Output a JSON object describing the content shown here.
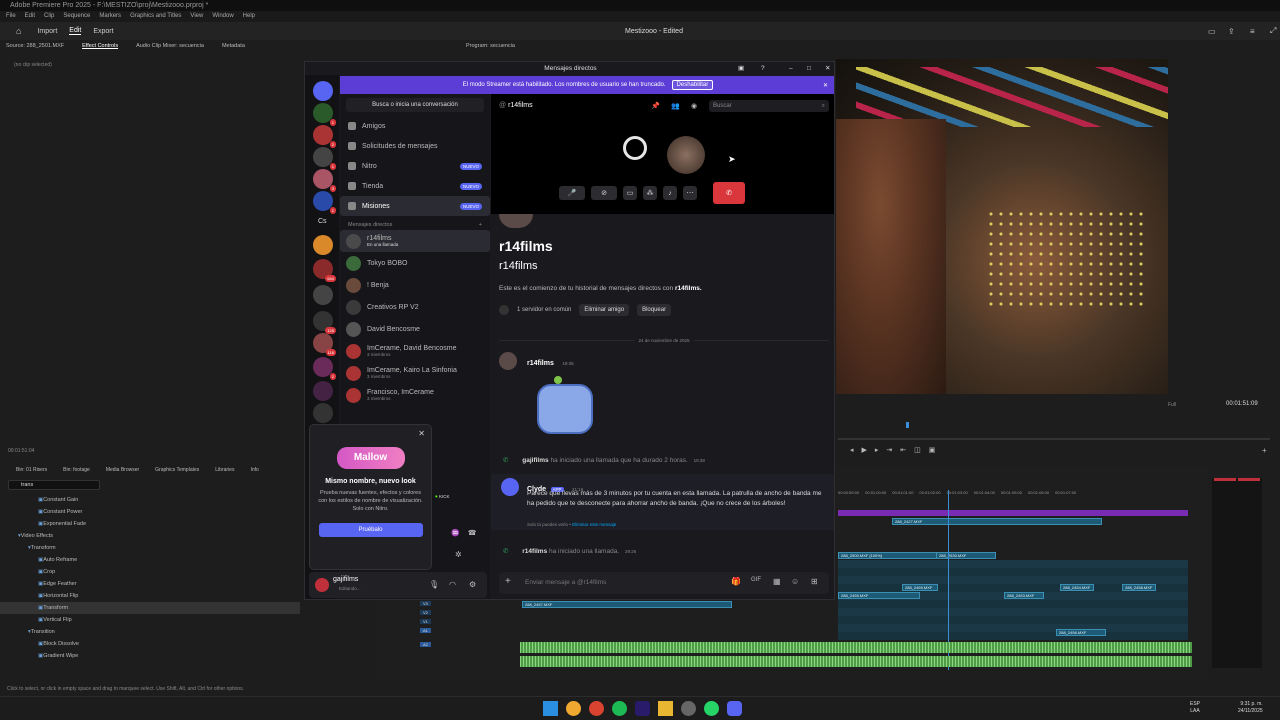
{
  "premiere": {
    "title": "Adobe Premiere Pro 2025 - F:\\MESTIZO\\proj\\Mestizooo.prproj *",
    "menu": [
      "File",
      "Edit",
      "Clip",
      "Sequence",
      "Markers",
      "Graphics and Titles",
      "View",
      "Window",
      "Help"
    ],
    "workspace_tabs": [
      "Import",
      "Edit",
      "Export"
    ],
    "project_name": "Mestizooo - Edited",
    "source_tabs": [
      "Source: 288_2501.MXF",
      "Effect Controls",
      "Audio Clip Mixer: secuencia",
      "Metadata"
    ],
    "no_clip": "(no clip selected)",
    "program_tab": "Program: secuencia",
    "source_timecode": "00:01:51:04",
    "program_zoom": "Full",
    "program_timecode": "00:01:51:09",
    "bin_tabs": [
      "Bin: 01 Risers",
      "Bin: footage",
      "Media Browser",
      "Graphics Templates",
      "Libraries",
      "Info"
    ],
    "effects_search": "trans",
    "effects_tree": [
      {
        "label": "Constant Gain",
        "indent": 2
      },
      {
        "label": "Constant Power",
        "indent": 2
      },
      {
        "label": "Exponential Fade",
        "indent": 2
      },
      {
        "label": "Video Effects",
        "indent": 0
      },
      {
        "label": "Transform",
        "indent": 1
      },
      {
        "label": "Auto Reframe",
        "indent": 2
      },
      {
        "label": "Crop",
        "indent": 2
      },
      {
        "label": "Edge Feather",
        "indent": 2
      },
      {
        "label": "Horizontal Flip",
        "indent": 2
      },
      {
        "label": "Transform",
        "indent": 2
      },
      {
        "label": "Vertical Flip",
        "indent": 2
      },
      {
        "label": "Transition",
        "indent": 1
      },
      {
        "label": "Block Dissolve",
        "indent": 2
      },
      {
        "label": "Gradient Wipe",
        "indent": 2
      }
    ],
    "ruler": [
      "00:01:00:00",
      "00:01:01:00",
      "00:01:02:00",
      "00:01:03:00",
      "00:01:04:00",
      "00:01:05:00",
      "00:01:06:00",
      "00:01:07:00"
    ],
    "ruler_first": "00:00:59:00",
    "track_labels": [
      "V3",
      "V2",
      "V1",
      "A1",
      "A2"
    ],
    "clips": [
      "288_2427.MXF",
      "288_2500.MXF [100%]",
      "288_2530.MXF",
      "288_2469.MXF",
      "288_2454.MXF",
      "288_2458.MXF",
      "288_2455.MXF",
      "288_2453.MXF",
      "288_2457.MXF",
      "288_2456.MXF"
    ],
    "status": "Click to select, or click in empty space and drag to marquee select. Use Shift, Alt, and Ctrl for other options."
  },
  "discord": {
    "window_title": "Mensajes directos",
    "streamer_banner": "El modo Streamer está habilitado. Los nombres de usuario se han truncado.",
    "banner_button": "Deshabilitar",
    "search_conversation": "Busca o inicia una conversación",
    "nav": [
      {
        "label": "Amigos",
        "badge": ""
      },
      {
        "label": "Solicitudes de mensajes",
        "badge": ""
      },
      {
        "label": "Nitro",
        "badge": "NUEVO"
      },
      {
        "label": "Tienda",
        "badge": "NUEVO"
      },
      {
        "label": "Misiones",
        "badge": "NUEVO"
      }
    ],
    "dm_header": "Mensajes directos",
    "dms": [
      {
        "name": "r14films",
        "sub": "En una llamada"
      },
      {
        "name": "Tokyo BOBO",
        "sub": ""
      },
      {
        "name": "! Benja",
        "sub": ""
      },
      {
        "name": "Creativos RP V2",
        "sub": ""
      },
      {
        "name": "David Bencosme",
        "sub": ""
      },
      {
        "name": "ImCerame, David Bencosme",
        "sub": "3 miembros"
      },
      {
        "name": "ImCerame, Kairo La Sinfonia",
        "sub": "3 miembros"
      },
      {
        "name": "Francisco, ImCerame",
        "sub": "3 miembros"
      }
    ],
    "guild_text": "Cs",
    "guild_badges": [
      "1",
      "2",
      "1",
      "3",
      "1",
      "644",
      "128",
      "116",
      "2"
    ],
    "channel_name": "r14films",
    "search_placeholder": "Buscar",
    "profile_name_big": "r14films",
    "profile_name": "r14films",
    "intro": "Este es el comienzo de tu historial de mensajes directos con ",
    "intro_bold": "r14films.",
    "mutual": "1 servidor en común",
    "remove_friend": "Eliminar amigo",
    "block": "Bloquear",
    "date_divider": "24 de noviembre de 2025",
    "messages": [
      {
        "author": "r14films",
        "time": "19:36"
      },
      {
        "system_user": "gajifilms",
        "text": "ha iniciado una llamada que ha durado 2 horas.",
        "time": "19:38"
      },
      {
        "author": "Clyde",
        "tag": "APP",
        "time": "21:16",
        "text": "Parece que llevas más de 3 minutos por tu cuenta en esta llamada. La patrulla de ancho de banda me ha pedido que te desconecte para ahorrar ancho de banda. ¡Que no crece de los árboles!",
        "footer": "Solo tú puedes verlo •",
        "footer_link": "Eliminar este mensaje"
      },
      {
        "system_user": "r14films",
        "text": "ha iniciado una llamada.",
        "time": "29:26"
      }
    ],
    "composer_placeholder": "Enviar mensaje a @r14films",
    "promo": {
      "logo_text": "Mallow",
      "title": "Mismo nombre, nuevo look",
      "body": "Prueba nuevas fuentes, efectos y colores con los estilos de nombre de visualización.",
      "body2": "Solo con Nitro.",
      "button": "Pruébalo"
    },
    "kick": "KICK",
    "user_name": "gajifilms",
    "user_status": "Editando..."
  },
  "taskbar": {
    "lang_top": "ESP",
    "lang_bottom": "LAA",
    "time": "9:31 p. m.",
    "date": "24/11/2025"
  },
  "colors": {
    "discord_blurple": "#5865f2",
    "banner": "#5c3ed6",
    "hangup": "#da373c",
    "premiere_clip": "#1c5a75",
    "audio": "#8bd77f"
  }
}
